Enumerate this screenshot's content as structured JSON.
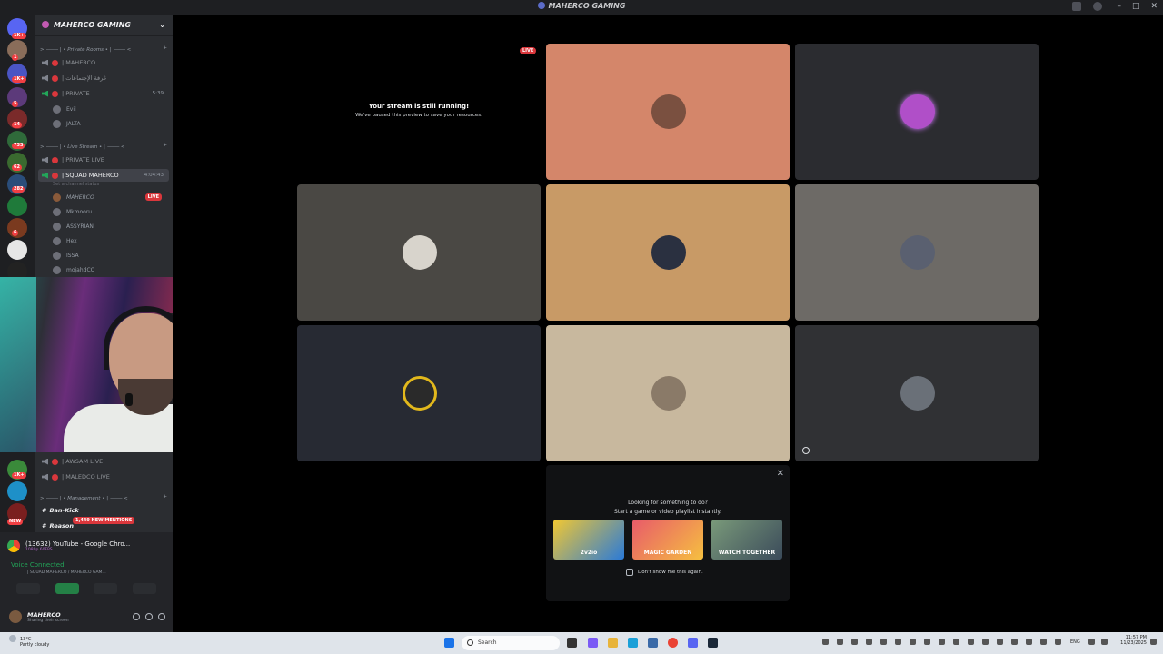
{
  "window": {
    "title": "MAHERCO GAMING"
  },
  "server_rail": {
    "badges": [
      "1K+",
      "1",
      "1K+",
      "5",
      "14",
      "733",
      "62",
      "282",
      "6",
      "1",
      "1K+"
    ],
    "new_label": "NEW"
  },
  "sidebar": {
    "guild_name": "MAHERCO GAMING",
    "categories": {
      "private_rooms": "Private Rooms",
      "live_stream": "Live Stream",
      "management": "Management"
    },
    "channels": {
      "c1": "| MAHERCO",
      "c2": "| غرفة الإجتماعات",
      "c3": "| PRIVATE",
      "c3_time": "5:39",
      "c4": "| PRIVATE LIVE",
      "c5": "| SQUAD MAHERCO",
      "c5_time": "4:04:43",
      "c5_status": "Set a channel status",
      "c6": "| AWSAM LIVE",
      "c7": "| MALEDCO LIVE",
      "c8": "Ban-Kick",
      "c9": "Reason"
    },
    "private_members": [
      "Evil",
      "JALTA"
    ],
    "squad_members": [
      "MAHERCO",
      "Mkmooru",
      "ASSYRIAN",
      "Hex",
      "ISSA",
      "mojahdCO"
    ],
    "live_label": "LIVE",
    "mentions": "1,449 NEW MENTIONS"
  },
  "user_panel": {
    "activity_title": "(13632) YouTube - Google Chro...",
    "activity_sub": "1080p 60FPS",
    "voice_connected": "Voice Connected",
    "voice_sub": "| SQUAD MAHERCO / MAHERCO GAM...",
    "username": "MAHERCO",
    "user_status": "Sharing their screen"
  },
  "stage": {
    "live_tag": "LIVE",
    "paused_title": "Your stream is still running!",
    "paused_sub": "We've paused this preview to save your resources."
  },
  "suggestion": {
    "line1": "Looking for something to do?",
    "line2": "Start a game or video playlist instantly.",
    "games": [
      "2v2io",
      "MAGIC GARDEN",
      "WATCH TOGETHER"
    ],
    "dont_show": "Don't show me this again."
  },
  "taskbar": {
    "temp": "13°C",
    "weather": "Partly cloudy",
    "search": "Search",
    "lang": "ENG",
    "time": "11:57 PM",
    "date": "11/23/2025"
  }
}
